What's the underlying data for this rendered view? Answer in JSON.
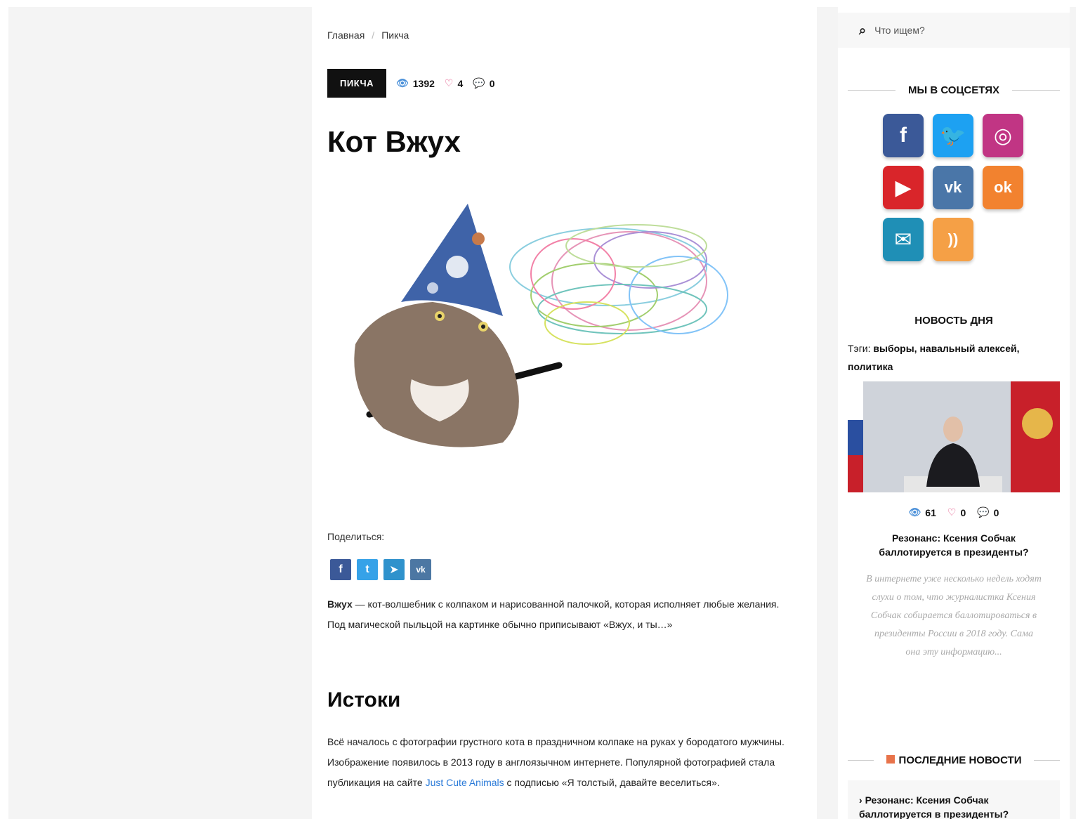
{
  "breadcrumb": {
    "home": "Главная",
    "current": "Пикча"
  },
  "post": {
    "category": "ПИКЧА",
    "views": "1392",
    "likes": "4",
    "comments": "0",
    "title": "Кот Вжух",
    "share_label": "Поделиться:",
    "intro_bold": "Вжух",
    "intro_text": " — кот-волшебник с колпаком и нарисованной палочкой, которая исполняет любые желания. Под магической пыльцой на картинке обычно приписывают «Вжух, и ты…»",
    "section_heading": "Истоки",
    "origin_text_before": "Всё началось с фотографии грустного кота в праздничном колпаке на руках у бородатого мужчины. Изображение появилось в 2013 году в англоязычном интернете. Популярной фотографией стала публикация на сайте ",
    "origin_link": "Just Cute Animals",
    "origin_text_after": " с подписью «Я толстый, давайте веселиться»."
  },
  "share_buttons": [
    {
      "name": "facebook",
      "glyph": "f",
      "color": "#3b5998"
    },
    {
      "name": "twitter",
      "glyph": "t",
      "color": "#36a2e8"
    },
    {
      "name": "telegram",
      "glyph": "➤",
      "color": "#2f92cc"
    },
    {
      "name": "vk",
      "glyph": "vk",
      "color": "#4c77a3"
    }
  ],
  "sidebar": {
    "search_placeholder": "Что ищем?",
    "social_title": "МЫ В СОЦСЕТЯХ",
    "social": [
      {
        "name": "facebook",
        "glyph": "f",
        "color": "#3b5998"
      },
      {
        "name": "twitter",
        "glyph": "🐦",
        "color": "#1da1f2"
      },
      {
        "name": "instagram",
        "glyph": "◎",
        "color": "#c13584"
      },
      {
        "name": "youtube",
        "glyph": "▶",
        "color": "#d9252a"
      },
      {
        "name": "vk",
        "glyph": "vk",
        "color": "#4a76a8"
      },
      {
        "name": "odnoklassniki",
        "glyph": "ok",
        "color": "#f2822f"
      },
      {
        "name": "email",
        "glyph": "✉",
        "color": "#1f8fb6"
      },
      {
        "name": "rss",
        "glyph": "))",
        "color": "#f5a046"
      }
    ],
    "news_of_day": {
      "title": "НОВОСТЬ ДНЯ",
      "tags_label": "Тэги:",
      "tags": "выборы, навальный алексей, политика",
      "views": "61",
      "likes": "0",
      "comments": "0",
      "headline": "Резонанс: Ксения Собчак баллотируется в президенты?",
      "excerpt": "В интернете уже несколько недель ходят слухи о том, что журналистка Ксения Собчак собирается баллотироваться в президенты России в 2018 году. Сама она эту информацию..."
    },
    "latest": {
      "title": "ПОСЛЕДНИЕ НОВОСТИ",
      "first_item": "Резонанс: Ксения Собчак баллотируется в президенты?"
    }
  }
}
